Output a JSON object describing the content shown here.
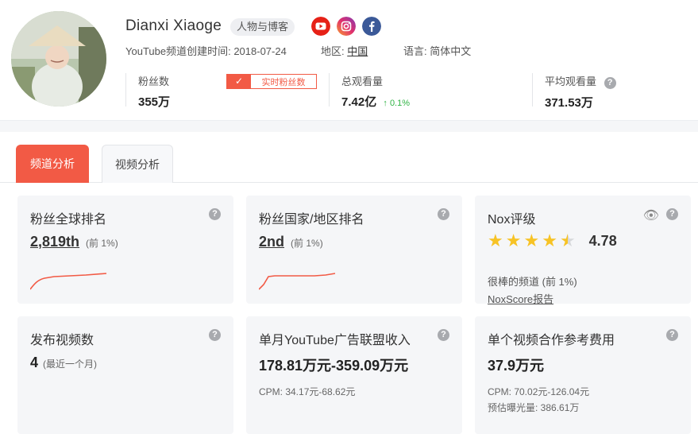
{
  "channel": {
    "name": "Dianxi Xiaoge",
    "category_tag": "人物与博客",
    "created_label": "YouTube频道创建时间:",
    "created_date": "2018-07-24",
    "region_label": "地区:",
    "region_value": "中国",
    "language_label": "语言:",
    "language_value": "简体中文",
    "social_icons": [
      "youtube-icon",
      "instagram-icon",
      "facebook-icon"
    ]
  },
  "stats": {
    "subscribers_label": "粉丝数",
    "subscribers_value": "355万",
    "realtime_button": "实时粉丝数",
    "total_views_label": "总观看量",
    "total_views_value": "7.42亿",
    "total_views_growth": "0.1%",
    "avg_views_label": "平均观看量",
    "avg_views_value": "371.53万"
  },
  "tabs": [
    {
      "label": "频道分析",
      "active": true
    },
    {
      "label": "视频分析",
      "active": false
    }
  ],
  "cards": {
    "global_rank": {
      "title": "粉丝全球排名",
      "value": "2,819th",
      "percent": "(前 1%)"
    },
    "country_rank": {
      "title": "粉丝国家/地区排名",
      "value": "2nd",
      "percent": "(前 1%)"
    },
    "nox": {
      "title": "Nox评级",
      "rating": 4.78,
      "score": "4.78",
      "desc": "很棒的频道 (前 1%)",
      "link": "NoxScore报告"
    },
    "videos": {
      "title": "发布视频数",
      "value": "4",
      "sub": "(最近一个月)"
    },
    "ad_income": {
      "title": "单月YouTube广告联盟收入",
      "value": "178.81万元-359.09万元",
      "cpm": "CPM: 34.17元-68.62元"
    },
    "coop_fee": {
      "title": "单个视频合作参考费用",
      "value": "37.9万元",
      "cpm": "CPM: 70.02元-126.04元",
      "exposure": "预估曝光量: 386.61万"
    }
  },
  "colors": {
    "accent": "#f25a45",
    "growth": "#2fb344",
    "star": "#f7c325"
  }
}
